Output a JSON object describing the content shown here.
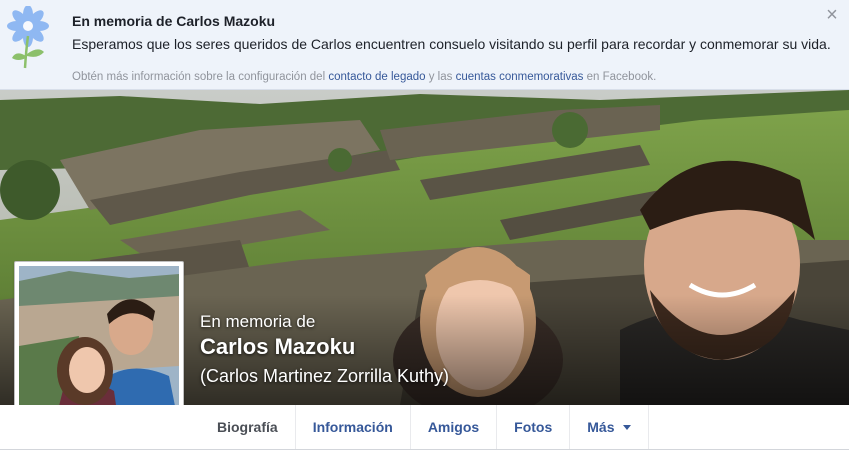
{
  "banner": {
    "title": "En memoria de Carlos Mazoku",
    "body": "Esperamos que los seres queridos de Carlos encuentren consuelo visitando su perfil para recordar y conmemorar su vida.",
    "foot_prefix": "Obtén más información sobre la configuración del ",
    "foot_link1": "contacto de legado",
    "foot_mid": " y las ",
    "foot_link2": "cuentas conmemorativas",
    "foot_suffix": " en Facebook.",
    "close_icon": "close-icon"
  },
  "profile": {
    "memorial_label": "En memoria de",
    "name": "Carlos Mazoku",
    "alternate_name": "(Carlos Martinez Zorrilla Kuthy)"
  },
  "nav": {
    "tabs": [
      "Biografía",
      "Información",
      "Amigos",
      "Fotos",
      "Más"
    ]
  },
  "colors": {
    "link": "#365899",
    "banner_bg": "#eef3fa",
    "page_bg": "#e9ebee"
  }
}
